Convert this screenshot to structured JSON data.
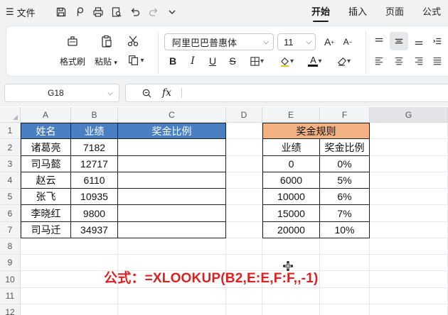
{
  "menubar": {
    "file_label": "文件",
    "tabs": [
      {
        "label": "开始",
        "active": true
      },
      {
        "label": "插入",
        "active": false
      },
      {
        "label": "页面",
        "active": false
      },
      {
        "label": "公式",
        "active": false
      }
    ]
  },
  "ribbon": {
    "format_painter_label": "格式刷",
    "paste_label": "粘贴",
    "font_name": "阿里巴巴普惠体",
    "font_size": "11",
    "bold": "B",
    "italic": "I",
    "underline": "U",
    "strike": "S"
  },
  "formula_bar": {
    "cell_ref": "G18",
    "fx": "fx",
    "content": ""
  },
  "columns": [
    "A",
    "B",
    "C",
    "D",
    "E",
    "F",
    "G"
  ],
  "rows": [
    "1",
    "2",
    "3",
    "4",
    "5",
    "6",
    "7",
    "8",
    "9",
    "10",
    "11",
    "12"
  ],
  "table_left": {
    "headers": [
      "姓名",
      "业绩",
      "奖金比例"
    ],
    "rows": [
      [
        "诸葛亮",
        "7182",
        ""
      ],
      [
        "司马懿",
        "12717",
        ""
      ],
      [
        "赵云",
        "6110",
        ""
      ],
      [
        "张飞",
        "10935",
        ""
      ],
      [
        "李晓红",
        "9800",
        ""
      ],
      [
        "司马迁",
        "34937",
        ""
      ]
    ]
  },
  "table_right": {
    "title": "奖金规则",
    "headers": [
      "业绩",
      "奖金比例"
    ],
    "rows": [
      [
        "0",
        "0%"
      ],
      [
        "6000",
        "5%"
      ],
      [
        "10000",
        "6%"
      ],
      [
        "15000",
        "7%"
      ],
      [
        "20000",
        "10%"
      ]
    ]
  },
  "annotation": "公式：=XLOOKUP(B2,E:E,F:F,,-1)",
  "colors": {
    "header_blue": "#4a7fc1",
    "header_orange": "#f4b183",
    "annotation_red": "#e02020"
  }
}
